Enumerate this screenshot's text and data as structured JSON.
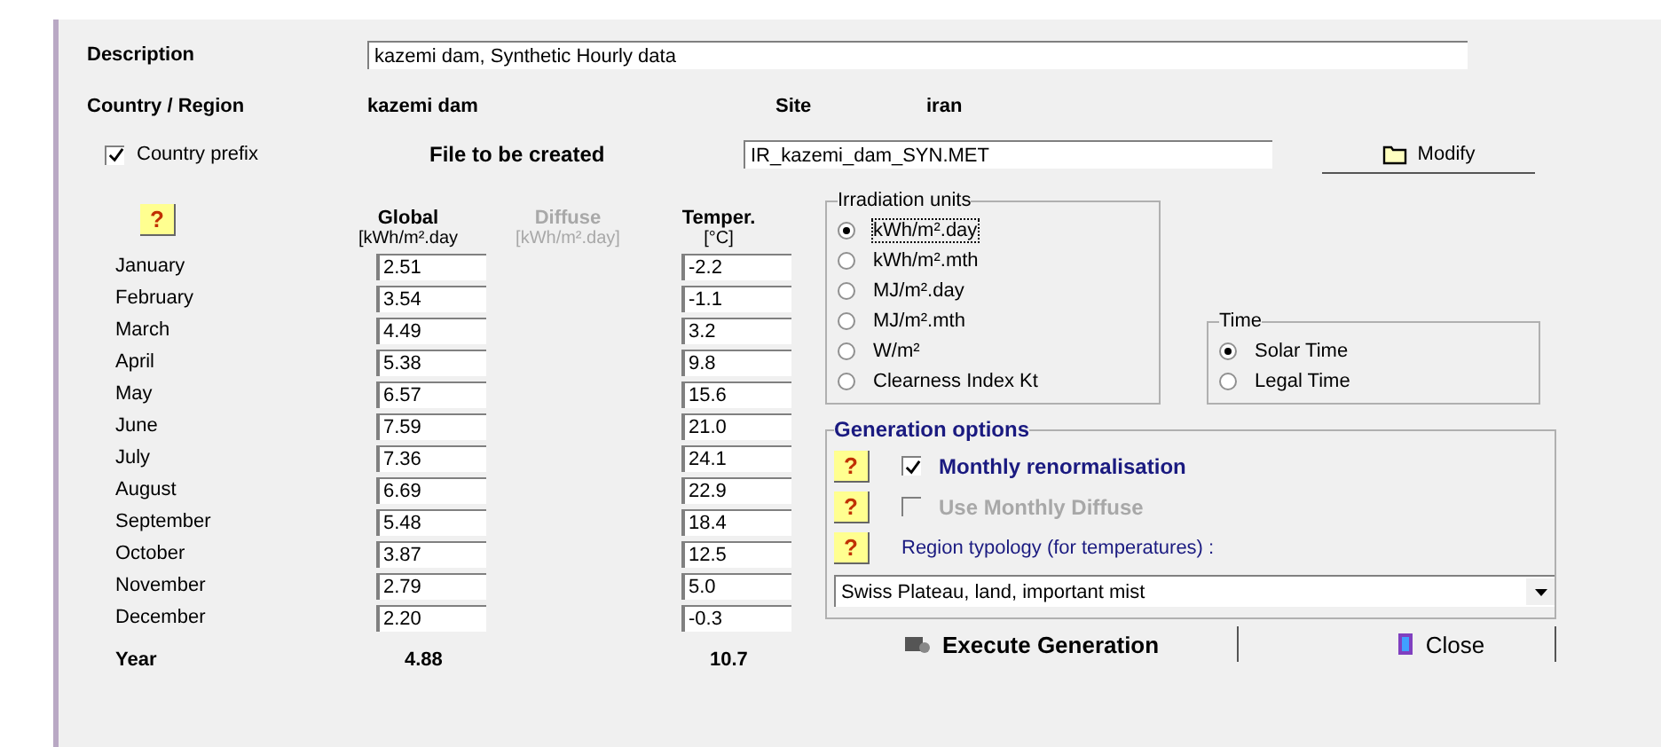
{
  "description": {
    "label": "Description",
    "value": "kazemi dam, Synthetic Hourly data"
  },
  "country": {
    "label": "Country / Region",
    "value": "kazemi dam"
  },
  "site": {
    "label": "Site",
    "value": "iran"
  },
  "country_prefix": {
    "label": "Country prefix",
    "checked": true
  },
  "file": {
    "label": "File to be created",
    "value": "IR_kazemi_dam_SYN.MET"
  },
  "modify_button": "Modify",
  "table": {
    "help": "?",
    "columns": [
      {
        "title": "Global",
        "unit": "[kWh/m².day",
        "disabled": false
      },
      {
        "title": "Diffuse",
        "unit": "[kWh/m².day]",
        "disabled": true
      },
      {
        "title": "Temper.",
        "unit": "[°C]",
        "disabled": false
      }
    ],
    "rows": [
      {
        "month": "January",
        "global": "2.51",
        "temp": "-2.2"
      },
      {
        "month": "February",
        "global": "3.54",
        "temp": "-1.1"
      },
      {
        "month": "March",
        "global": "4.49",
        "temp": "3.2"
      },
      {
        "month": "April",
        "global": "5.38",
        "temp": "9.8"
      },
      {
        "month": "May",
        "global": "6.57",
        "temp": "15.6"
      },
      {
        "month": "June",
        "global": "7.59",
        "temp": "21.0"
      },
      {
        "month": "July",
        "global": "7.36",
        "temp": "24.1"
      },
      {
        "month": "August",
        "global": "6.69",
        "temp": "22.9"
      },
      {
        "month": "September",
        "global": "5.48",
        "temp": "18.4"
      },
      {
        "month": "October",
        "global": "3.87",
        "temp": "12.5"
      },
      {
        "month": "November",
        "global": "2.79",
        "temp": "5.0"
      },
      {
        "month": "December",
        "global": "2.20",
        "temp": "-0.3"
      }
    ],
    "year": {
      "label": "Year",
      "global": "4.88",
      "temp": "10.7"
    }
  },
  "irradiation_units": {
    "title": "Irradiation units",
    "options": [
      {
        "label": "kWh/m².day",
        "selected": true
      },
      {
        "label": "kWh/m².mth",
        "selected": false
      },
      {
        "label": "MJ/m².day",
        "selected": false
      },
      {
        "label": "MJ/m².mth",
        "selected": false
      },
      {
        "label": "W/m²",
        "selected": false
      },
      {
        "label": "Clearness Index Kt",
        "selected": false
      }
    ]
  },
  "time": {
    "title": "Time",
    "options": [
      {
        "label": "Solar Time",
        "selected": true
      },
      {
        "label": "Legal Time",
        "selected": false
      }
    ]
  },
  "generation_options": {
    "title": "Generation options",
    "items": [
      {
        "kind": "checkbox",
        "help": "?",
        "label": "Monthly renormalisation",
        "checked": true,
        "disabled": false
      },
      {
        "kind": "checkbox",
        "help": "?",
        "label": "Use Monthly Diffuse",
        "checked": false,
        "disabled": true
      },
      {
        "kind": "label",
        "help": "?",
        "label": "Region typology  (for temperatures) :"
      }
    ],
    "dropdown": {
      "value": "Swiss Plateau, land, important mist"
    }
  },
  "buttons": [
    {
      "kind": "execute",
      "label": "Execute Generation"
    },
    {
      "kind": "close",
      "label": "Close"
    }
  ]
}
